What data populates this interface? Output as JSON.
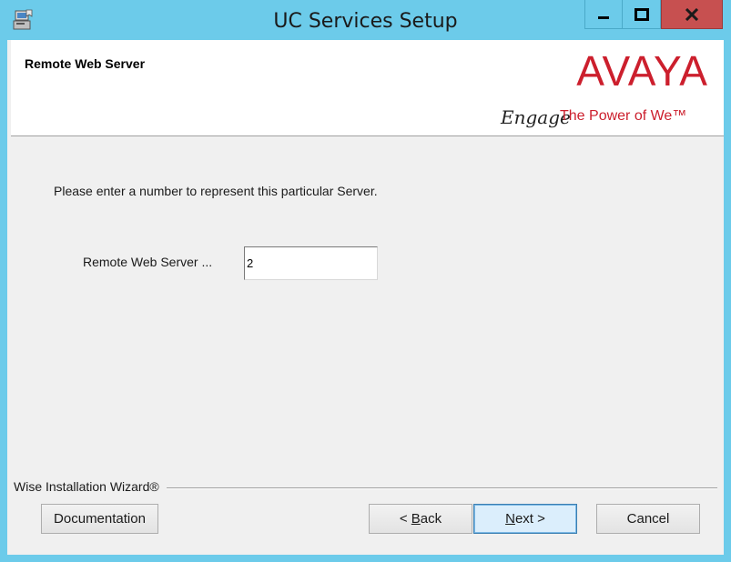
{
  "window": {
    "title": "UC Services Setup",
    "controls": {
      "minimize": "minimize",
      "maximize": "maximize",
      "close": "close"
    },
    "close_color": "#c75050",
    "frame_color": "#6ccbea"
  },
  "header": {
    "page_title": "Remote Web Server",
    "logo": {
      "brand": "AVAYA",
      "tagline_script": "Engage",
      "tagline": "The Power of We™",
      "color": "#cc1f2d"
    }
  },
  "main": {
    "instruction": "Please enter a number to represent this particular Server.",
    "field": {
      "label": "Remote Web Server ...",
      "value": "2"
    }
  },
  "footer": {
    "brand": "Wise Installation Wizard®",
    "buttons": {
      "documentation": "Documentation",
      "back_prefix": "< ",
      "back_mnemonic": "B",
      "back_rest": "ack",
      "next_mnemonic": "N",
      "next_rest": "ext >",
      "cancel": "Cancel"
    }
  }
}
